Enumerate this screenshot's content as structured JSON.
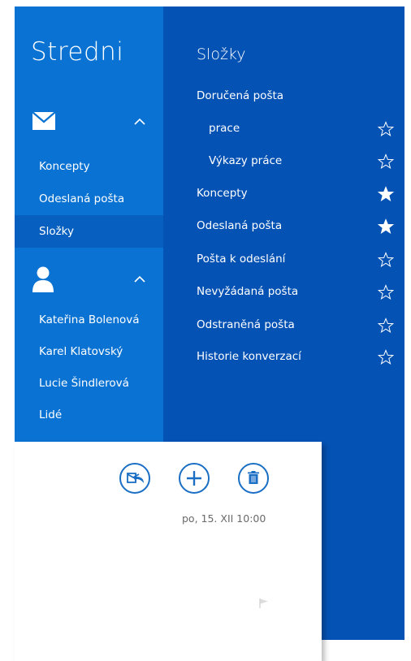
{
  "app": {
    "title": "Stredni"
  },
  "nav": {
    "mail_items": [
      {
        "label": "Koncepty",
        "selected": false
      },
      {
        "label": "Odeslaná pošta",
        "selected": false
      },
      {
        "label": "Složky",
        "selected": true
      }
    ],
    "people_items": [
      {
        "label": "Kateřina Bolenová"
      },
      {
        "label": "Karel Klatovský"
      },
      {
        "label": "Lucie Šindlerová"
      },
      {
        "label": "Lidé"
      }
    ]
  },
  "folders": {
    "title": "Složky",
    "items": [
      {
        "label": "Doručená pošta",
        "indent": 0,
        "favorite": null
      },
      {
        "label": "prace",
        "indent": 1,
        "favorite": false
      },
      {
        "label": "Výkazy práce",
        "indent": 1,
        "favorite": false
      },
      {
        "label": "Koncepty",
        "indent": 0,
        "favorite": true
      },
      {
        "label": "Odeslaná pošta",
        "indent": 0,
        "favorite": true
      },
      {
        "label": "Pošta k odeslání",
        "indent": 0,
        "favorite": false
      },
      {
        "label": "Nevyžádaná pošta",
        "indent": 0,
        "favorite": false
      },
      {
        "label": "Odstraněná pošta",
        "indent": 0,
        "favorite": false
      },
      {
        "label": "Historie konverzací",
        "indent": 0,
        "favorite": false
      }
    ]
  },
  "message": {
    "timestamp": "po, 15. XII  10:00",
    "actions": [
      "reply-icon",
      "plus-icon",
      "trash-icon"
    ]
  },
  "colors": {
    "nav_bg": "#0a72d2",
    "folders_bg": "#0452b4",
    "selected_bg": "#0760c0",
    "accent": "#1a6fc4"
  }
}
